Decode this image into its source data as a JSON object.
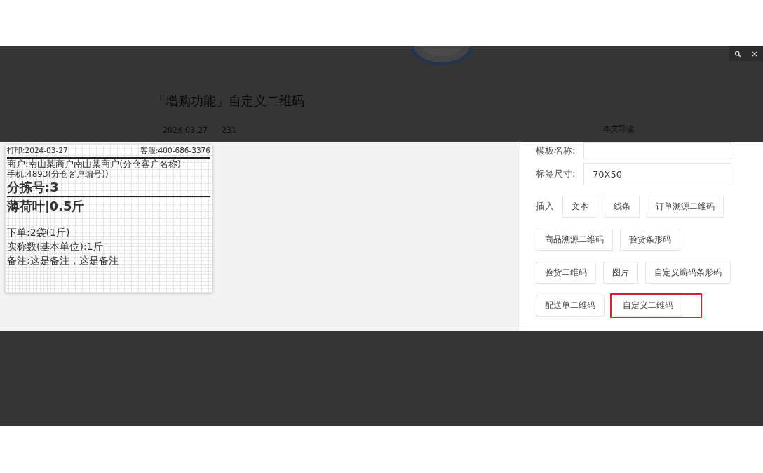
{
  "background_page": {
    "title": "「增购功能」自定义二维码",
    "date": "2024-03-27",
    "views": "231",
    "toc_heading": "本文导读"
  },
  "label_preview": {
    "print_date": "打印:2024-03-27",
    "service": "客服:400-686-3376",
    "merchant": "商户:南山某商户南山某商户(分仓客户名称)",
    "phone": "手机:4893(分仓客户编号))",
    "sort_number": "分拣号:3",
    "product": "薄荷叶|0.5斤",
    "lines": [
      "下单:2袋(1斤)",
      "实称数(基本单位):1斤",
      "备注:这是备注，这是备注"
    ]
  },
  "editor": {
    "template_name": {
      "label": "模板名称:"
    },
    "label_size": {
      "label": "标签尺寸:",
      "value": "70X50"
    },
    "insert_label": "插入",
    "button_rows": [
      [
        {
          "label": "文本",
          "selected": false
        },
        {
          "label": "线条",
          "selected": false
        },
        {
          "label": "订单溯源二维码",
          "selected": false
        }
      ],
      [
        {
          "label": "商品溯源二维码",
          "selected": false
        },
        {
          "label": "验货条形码",
          "selected": false
        }
      ],
      [
        {
          "label": "验货二维码",
          "selected": false
        },
        {
          "label": "图片",
          "selected": false
        },
        {
          "label": "自定义编码条形码",
          "selected": false
        }
      ],
      [
        {
          "label": "配送单二维码",
          "selected": false
        },
        {
          "label": "自定义二维码",
          "selected": true
        }
      ]
    ]
  }
}
